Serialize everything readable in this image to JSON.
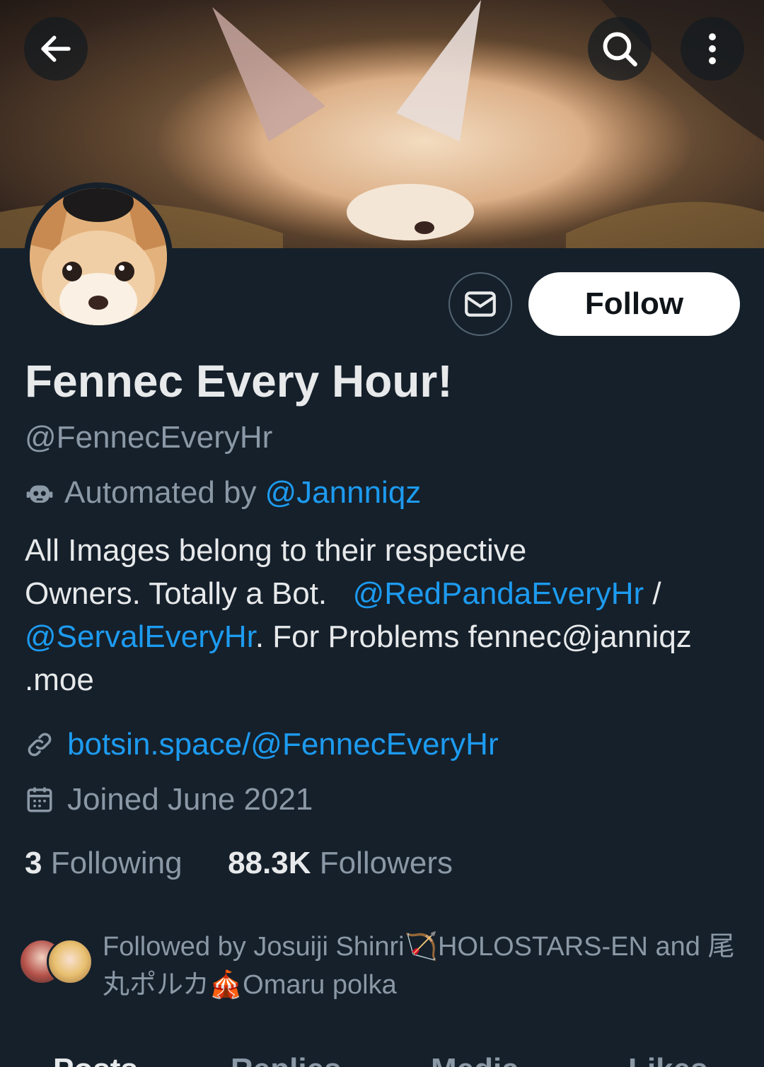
{
  "profile": {
    "name": "Fennec Every Hour!",
    "handle": "@FennecEveryHr",
    "automated_prefix": "Automated by",
    "automated_by": "@Jannniqz",
    "bio": {
      "line1": "All Images belong to their respective",
      "line2_text": "Owners. Totally a Bot.",
      "mention1": "@RedPandaEveryHr",
      "slash": "/",
      "mention2": "@ServalEveryHr",
      "line3_text": ". For Problems fennec@janniqz",
      "line4": ".moe"
    },
    "website": "botsin.space/@FennecEveryHr",
    "joined": "Joined June 2021",
    "following_count": "3",
    "following_label": "Following",
    "followers_count": "88.3K",
    "followers_label": "Followers",
    "followed_by": "Followed by Josuiji Shinri🏹HOLOSTARS-EN and 尾丸ポルカ🎪Omaru polka"
  },
  "buttons": {
    "follow": "Follow"
  },
  "tabs": [
    "Posts",
    "Replies",
    "Media",
    "Likes"
  ],
  "icons": {
    "back": "arrow-left-icon",
    "search": "search-icon",
    "more": "more-vertical-icon",
    "message": "envelope-icon",
    "bot": "robot-icon",
    "link": "link-icon",
    "calendar": "calendar-icon"
  },
  "colors": {
    "background": "#15202b",
    "accent": "#1d9bf0",
    "secondary_text": "#8b98a5"
  }
}
